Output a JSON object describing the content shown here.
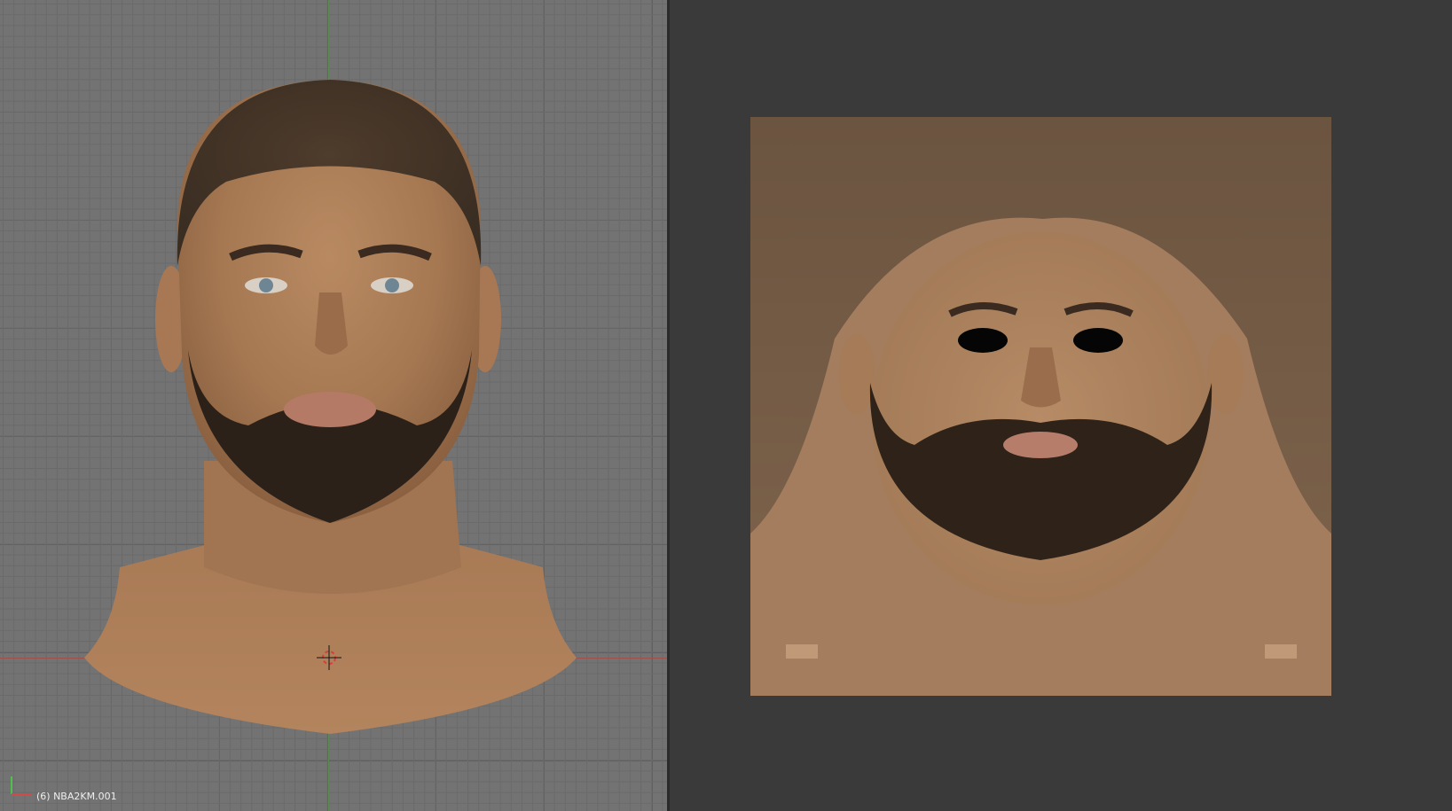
{
  "viewport": {
    "status_text": "(6) NBA2KM.001",
    "grid_color": "#737373",
    "x_axis_color": "#a0504a",
    "y_axis_color": "#5d8a52"
  },
  "uv_editor": {
    "background_color": "#3a3a3a"
  },
  "icons": {
    "axis_widget": "axis-gizmo-icon",
    "cursor": "3d-cursor-icon"
  }
}
